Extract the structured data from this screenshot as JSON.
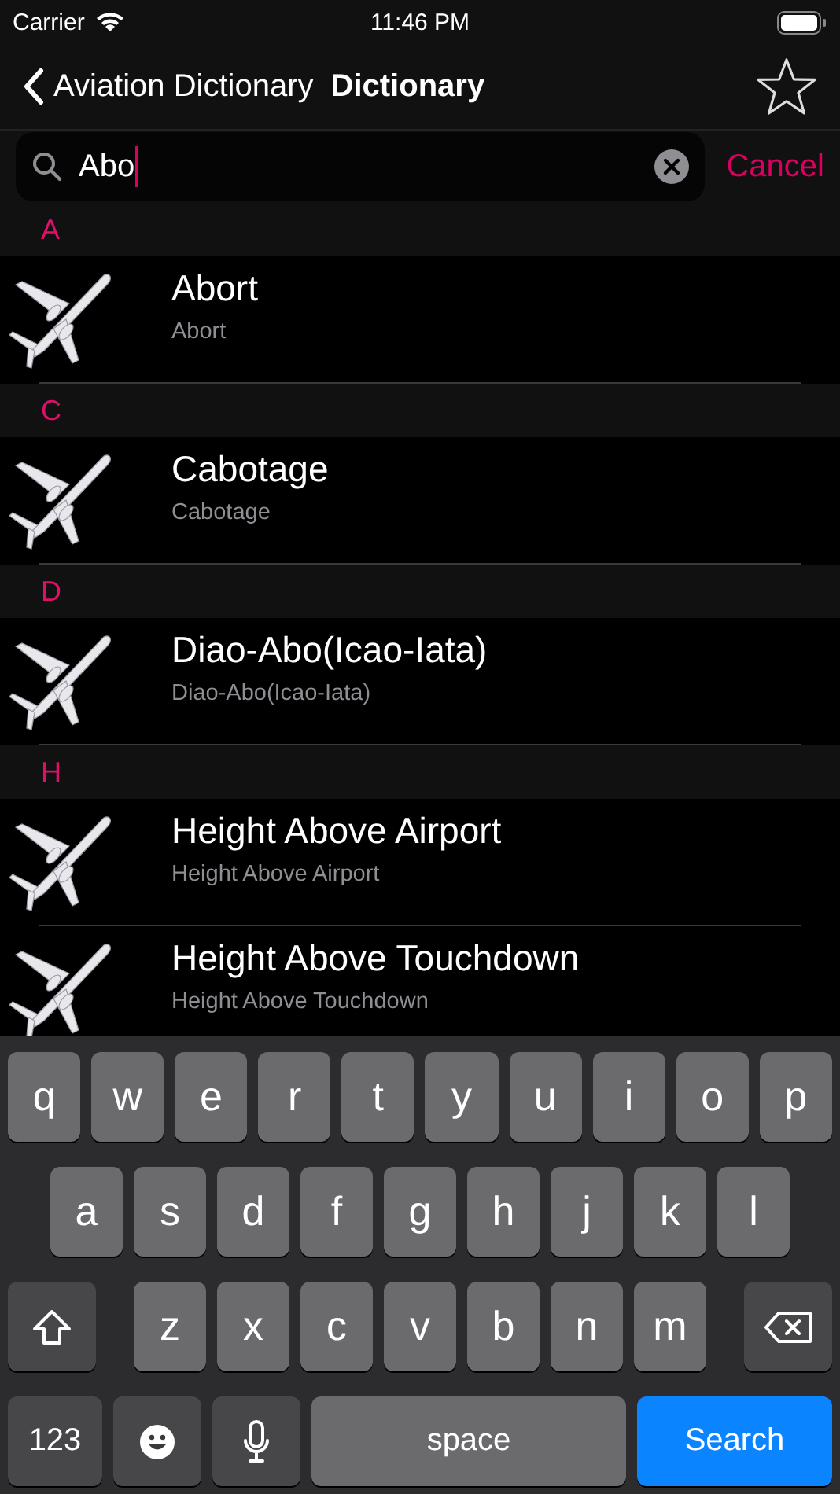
{
  "status_bar": {
    "carrier": "Carrier",
    "time": "11:46 PM"
  },
  "nav": {
    "back_label": "Aviation Dictionary",
    "title": "Dictionary"
  },
  "search": {
    "value": "Abo",
    "cancel": "Cancel"
  },
  "sections": [
    {
      "letter": "A",
      "entries": [
        {
          "title": "Abort",
          "subtitle": "Abort"
        }
      ]
    },
    {
      "letter": "C",
      "entries": [
        {
          "title": "Cabotage",
          "subtitle": "Cabotage"
        }
      ]
    },
    {
      "letter": "D",
      "entries": [
        {
          "title": "Diao-Abo(Icao-Iata)",
          "subtitle": "Diao-Abo(Icao-Iata)"
        }
      ]
    },
    {
      "letter": "H",
      "entries": [
        {
          "title": "Height Above Airport",
          "subtitle": "Height Above Airport"
        },
        {
          "title": "Height Above Touchdown",
          "subtitle": "Height Above Touchdown"
        }
      ]
    }
  ],
  "keyboard": {
    "rows": [
      {
        "keys": [
          {
            "kind": "letter",
            "label": "q"
          },
          {
            "kind": "letter",
            "label": "w"
          },
          {
            "kind": "letter",
            "label": "e"
          },
          {
            "kind": "letter",
            "label": "r"
          },
          {
            "kind": "letter",
            "label": "t"
          },
          {
            "kind": "letter",
            "label": "y"
          },
          {
            "kind": "letter",
            "label": "u"
          },
          {
            "kind": "letter",
            "label": "i"
          },
          {
            "kind": "letter",
            "label": "o"
          },
          {
            "kind": "letter",
            "label": "p"
          }
        ]
      },
      {
        "keys": [
          {
            "kind": "letter",
            "label": "a"
          },
          {
            "kind": "letter",
            "label": "s"
          },
          {
            "kind": "letter",
            "label": "d"
          },
          {
            "kind": "letter",
            "label": "f"
          },
          {
            "kind": "letter",
            "label": "g"
          },
          {
            "kind": "letter",
            "label": "h"
          },
          {
            "kind": "letter",
            "label": "j"
          },
          {
            "kind": "letter",
            "label": "k"
          },
          {
            "kind": "letter",
            "label": "l"
          }
        ]
      },
      {
        "keys": [
          {
            "kind": "shift"
          },
          {
            "kind": "letter",
            "label": "z"
          },
          {
            "kind": "letter",
            "label": "x"
          },
          {
            "kind": "letter",
            "label": "c"
          },
          {
            "kind": "letter",
            "label": "v"
          },
          {
            "kind": "letter",
            "label": "b"
          },
          {
            "kind": "letter",
            "label": "n"
          },
          {
            "kind": "letter",
            "label": "m"
          },
          {
            "kind": "delete"
          }
        ]
      },
      {
        "keys": [
          {
            "kind": "numbers",
            "label": "123"
          },
          {
            "kind": "emoji"
          },
          {
            "kind": "mic"
          },
          {
            "kind": "space",
            "label": "space"
          },
          {
            "kind": "search",
            "label": "Search"
          }
        ]
      }
    ]
  }
}
